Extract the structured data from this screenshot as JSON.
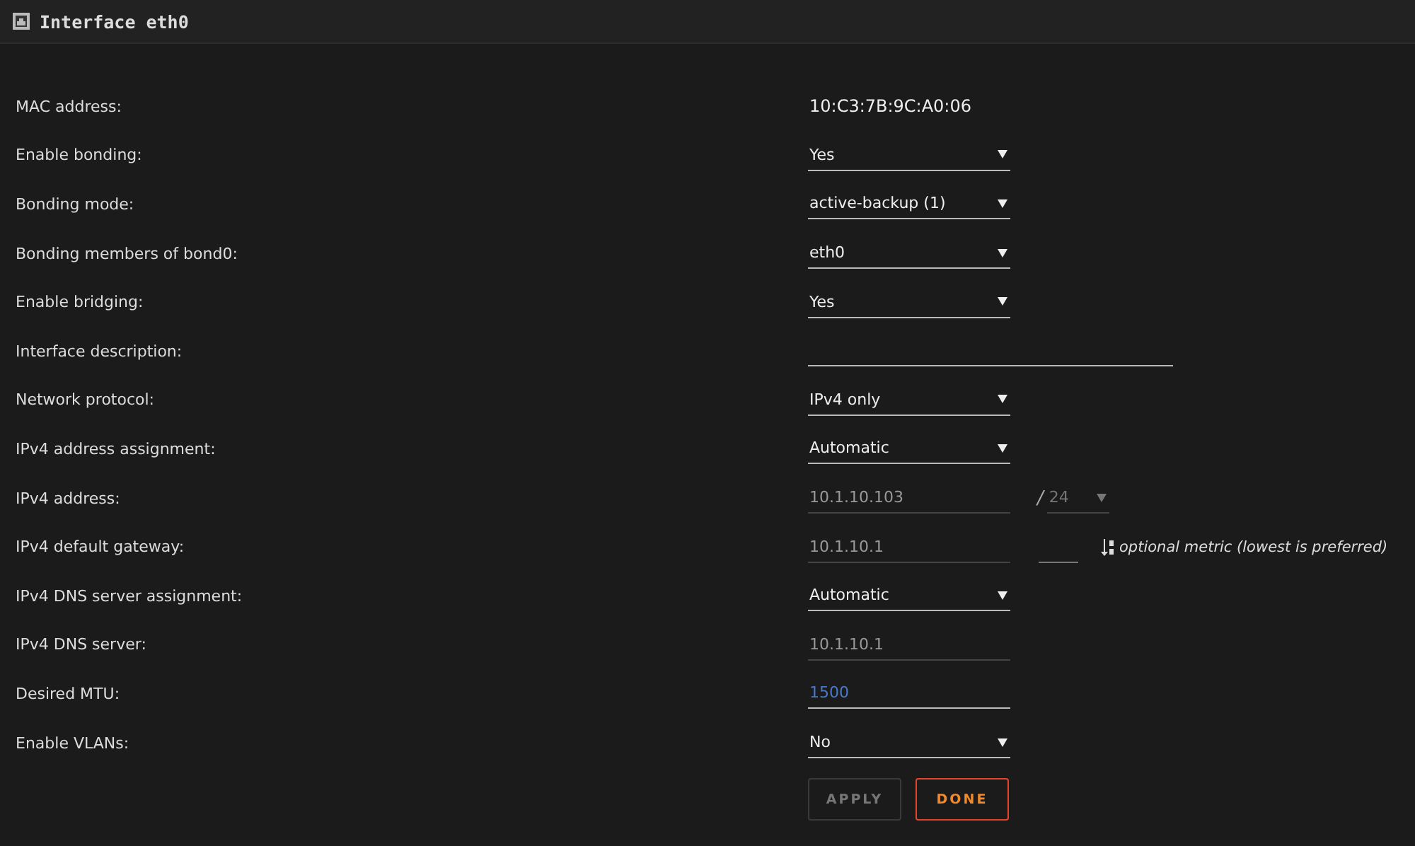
{
  "window": {
    "title": "Interface eth0"
  },
  "rows": [
    {
      "label": "MAC address:",
      "kind": "text",
      "value": "10:C3:7B:9C:A0:06"
    },
    {
      "label": "Enable bonding:",
      "kind": "select",
      "value": "Yes",
      "disabled": false
    },
    {
      "label": "Bonding mode:",
      "kind": "select",
      "value": "active-backup (1)",
      "disabled": false
    },
    {
      "label": "Bonding members of bond0:",
      "kind": "select",
      "value": "eth0",
      "disabled": false
    },
    {
      "label": "Enable bridging:",
      "kind": "select",
      "value": "Yes",
      "disabled": false
    },
    {
      "label": "Interface description:",
      "kind": "wide-input"
    },
    {
      "label": "Network protocol:",
      "kind": "select",
      "value": "IPv4 only",
      "disabled": false
    },
    {
      "label": "IPv4 address assignment:",
      "kind": "select",
      "value": "Automatic",
      "disabled": false
    },
    {
      "label": "IPv4 address:",
      "kind": "input",
      "value": "10.1.10.103",
      "disabled": true,
      "separator": "/",
      "prefix": {
        "value": "24",
        "disabled": true
      }
    },
    {
      "label": "IPv4 default gateway:",
      "kind": "input",
      "value": "10.1.10.1",
      "disabled": true,
      "metric": {
        "hint": "optional metric (lowest is preferred)"
      }
    },
    {
      "label": "IPv4 DNS server assignment:",
      "kind": "select",
      "value": "Automatic",
      "disabled": false
    },
    {
      "label": "IPv4 DNS server:",
      "kind": "input",
      "value": "10.1.10.1",
      "disabled": true
    },
    {
      "label": "Desired MTU:",
      "kind": "input",
      "value": "1500",
      "disabled": false
    },
    {
      "label": "Enable VLANs:",
      "kind": "select",
      "value": "No",
      "disabled": false
    }
  ],
  "buttons": [
    {
      "label": "APPLY",
      "kind": "apply",
      "disabled": true
    },
    {
      "label": "DONE",
      "kind": "done",
      "disabled": false
    }
  ]
}
